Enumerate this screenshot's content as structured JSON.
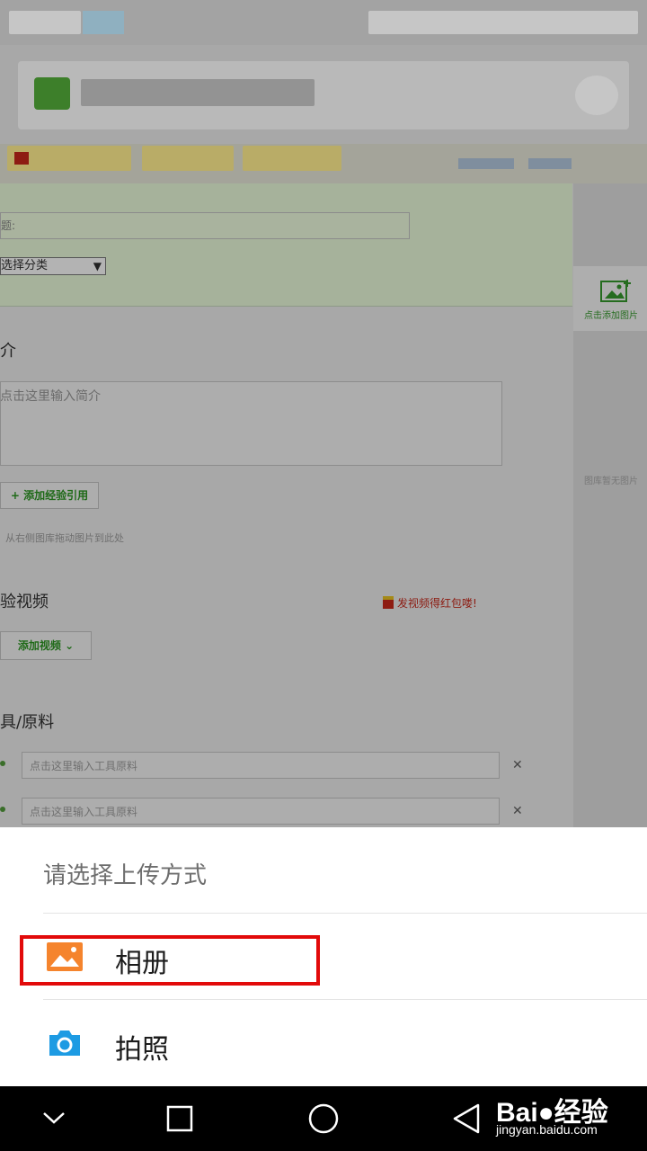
{
  "background_page": {
    "title_field_label": "题:",
    "category_select": "选择分类",
    "gallery_add_label": "点击添加图片",
    "gallery_empty": "图库暂无图片",
    "intro_heading": "介",
    "intro_placeholder": "点击这里输入简介",
    "add_reference": "+ 添加经验引用",
    "drag_hint": "从右侧图库拖动图片到此处",
    "video_heading": "验视频",
    "video_prize": "发视频得红包喽!",
    "add_video": "添加视频",
    "tools_heading": "具/原料",
    "tool_placeholder": "点击这里输入工具原料"
  },
  "upload_sheet": {
    "title": "请选择上传方式",
    "options": [
      {
        "label": "相册",
        "icon": "album-icon"
      },
      {
        "label": "拍照",
        "icon": "camera-icon"
      }
    ],
    "album_color": "#f5842d",
    "camera_color": "#1d9be3",
    "highlight_color": "#e20a0a"
  },
  "navbar": {
    "watermark_logo": "Bai●经验",
    "watermark_url": "jingyan.baidu.com"
  }
}
